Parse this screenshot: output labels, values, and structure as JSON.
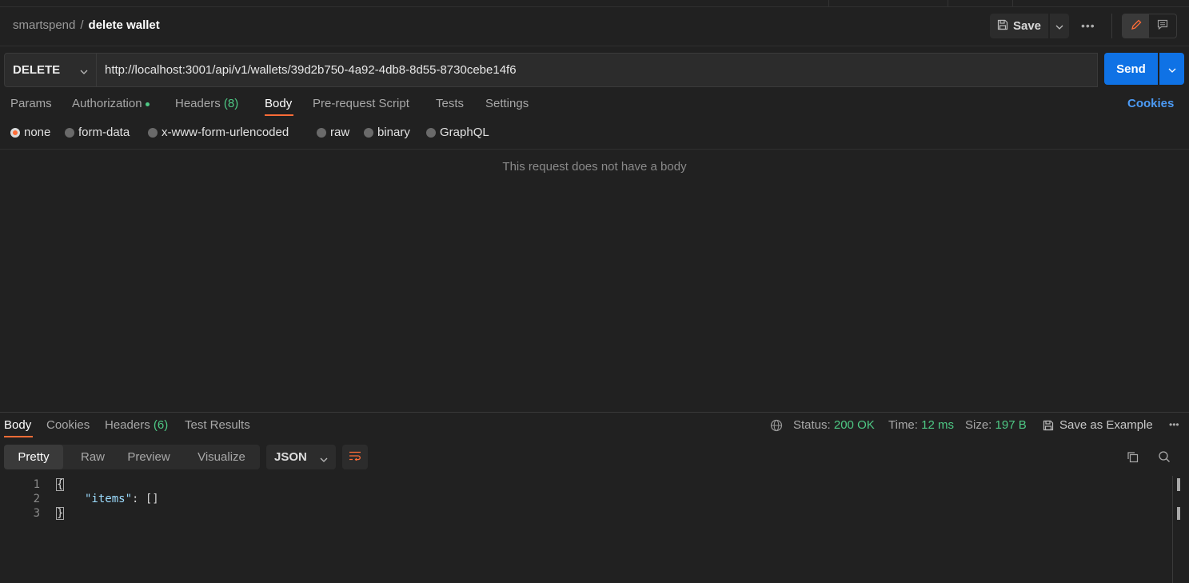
{
  "breadcrumb": {
    "parent": "smartspend",
    "separator": "/",
    "current": "delete wallet"
  },
  "toolbar": {
    "save_label": "Save",
    "more": "•••"
  },
  "request": {
    "method": "DELETE",
    "url": "http://localhost:3001/api/v1/wallets/39d2b750-4a92-4db8-8d55-8730cebe14f6",
    "send_label": "Send"
  },
  "request_tabs": {
    "params": "Params",
    "authorization": "Authorization",
    "headers": "Headers",
    "headers_count": "(8)",
    "body": "Body",
    "prerequest": "Pre-request Script",
    "tests": "Tests",
    "settings": "Settings",
    "active": "Body"
  },
  "cookies_link": "Cookies",
  "body_types": {
    "none": "none",
    "form_data": "form-data",
    "urlencoded": "x-www-form-urlencoded",
    "raw": "raw",
    "binary": "binary",
    "graphql": "GraphQL",
    "selected": "none"
  },
  "no_body_message": "This request does not have a body",
  "response": {
    "tabs": {
      "body": "Body",
      "cookies": "Cookies",
      "headers": "Headers",
      "headers_count": "(6)",
      "test_results": "Test Results",
      "active": "Body"
    },
    "status_label": "Status:",
    "status_value": "200 OK",
    "time_label": "Time:",
    "time_value": "12 ms",
    "size_label": "Size:",
    "size_value": "197 B",
    "save_example": "Save as Example",
    "more": "•••",
    "views": {
      "pretty": "Pretty",
      "raw": "Raw",
      "preview": "Preview",
      "visualize": "Visualize",
      "active": "Pretty"
    },
    "format": "JSON",
    "code": {
      "line_numbers": [
        "1",
        "2",
        "3"
      ],
      "open_brace": "{",
      "key": "\"items\"",
      "value": ": []",
      "close_brace": "}"
    }
  },
  "colors": {
    "accent": "#ff6c37",
    "send": "#0f72e5",
    "success": "#4ec985",
    "link": "#4c9bf5",
    "background": "#212121"
  },
  "icons": [
    "save-icon",
    "chevron-down-icon",
    "more-icon",
    "edit-icon",
    "comment-icon",
    "globe-icon",
    "copy-icon",
    "search-icon",
    "wrap-lines-icon"
  ]
}
